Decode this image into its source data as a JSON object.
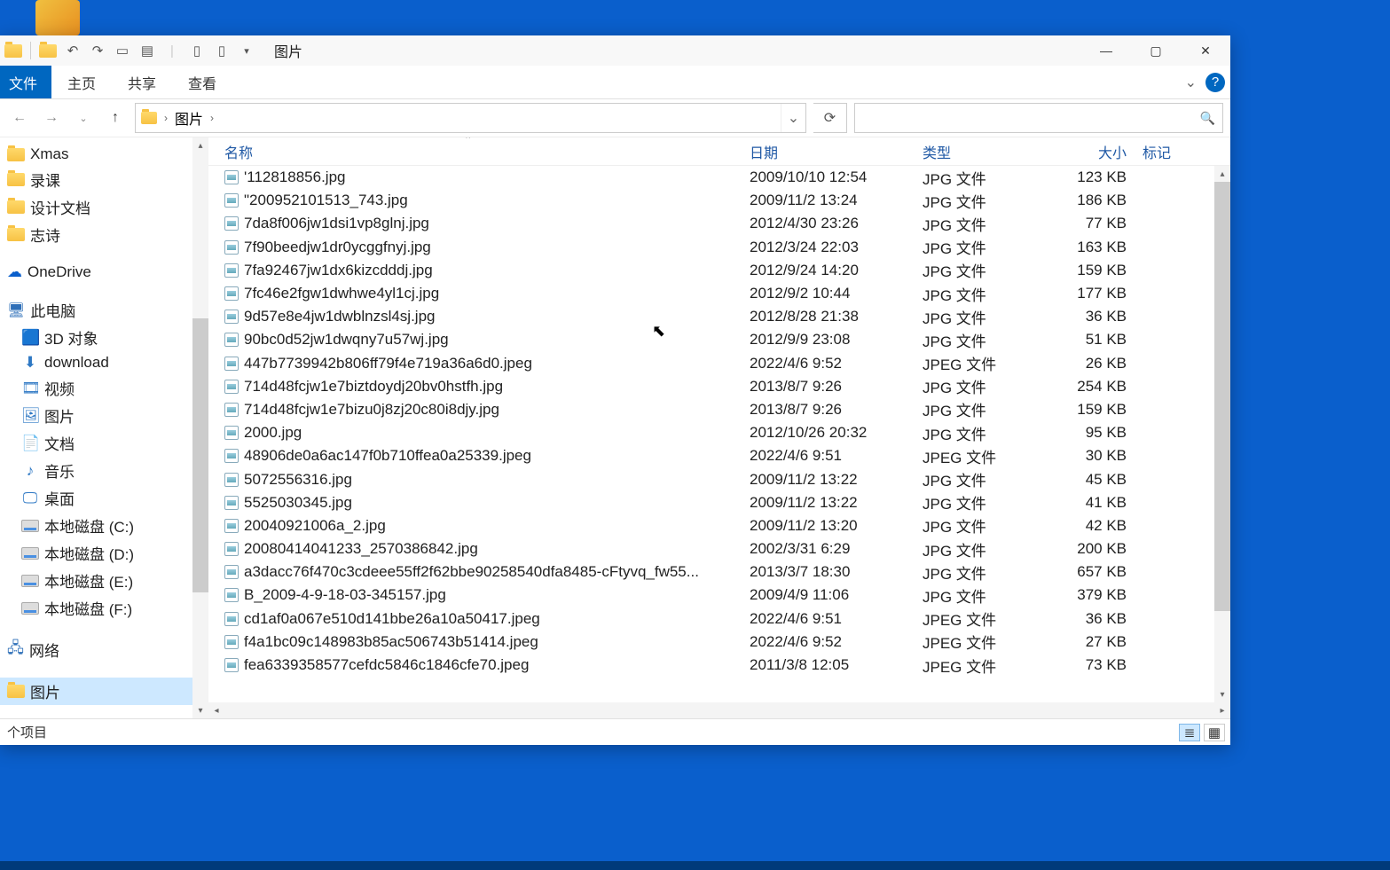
{
  "window_title": "图片",
  "win_controls": {
    "min": "—",
    "max": "▢",
    "close": "✕"
  },
  "qat": {
    "undo": "↶",
    "redo": "↷",
    "delete": "✕",
    "separator_small": "▾"
  },
  "ribbon": {
    "file": "文件",
    "tabs": [
      "主页",
      "共享",
      "查看"
    ],
    "help": "?",
    "expand": "⌄"
  },
  "nav": {
    "back": "←",
    "forward": "→",
    "up": "↑"
  },
  "breadcrumb": {
    "segments": [
      "图片"
    ],
    "chev": "›"
  },
  "refresh": "⟳",
  "search_placeholder": "",
  "search_icon": "🔍",
  "nav_pane": {
    "quick": [
      {
        "label": "Xmas"
      },
      {
        "label": "录课"
      },
      {
        "label": "设计文档"
      },
      {
        "label": "志诗"
      }
    ],
    "onedrive": "OneDrive",
    "this_pc": "此电脑",
    "pc_items": [
      {
        "label": "3D 对象",
        "icon": "3d"
      },
      {
        "label": "download",
        "icon": "download"
      },
      {
        "label": "视频",
        "icon": "video"
      },
      {
        "label": "图片",
        "icon": "pictures"
      },
      {
        "label": "文档",
        "icon": "docs"
      },
      {
        "label": "音乐",
        "icon": "music"
      },
      {
        "label": "桌面",
        "icon": "desktop"
      },
      {
        "label": "本地磁盘 (C:)",
        "icon": "drive"
      },
      {
        "label": "本地磁盘 (D:)",
        "icon": "drive"
      },
      {
        "label": "本地磁盘 (E:)",
        "icon": "drive"
      },
      {
        "label": "本地磁盘 (F:)",
        "icon": "drive"
      }
    ],
    "network": "网络",
    "selected": "图片"
  },
  "columns": {
    "name": "名称",
    "date": "日期",
    "type": "类型",
    "size": "大小",
    "tag": "标记",
    "sort_ind": "⌃"
  },
  "files": [
    {
      "name": "'112818856.jpg",
      "date": "2009/10/10 12:54",
      "type": "JPG 文件",
      "size": "123 KB"
    },
    {
      "name": "\"200952101513_743.jpg",
      "date": "2009/11/2 13:24",
      "type": "JPG 文件",
      "size": "186 KB"
    },
    {
      "name": "7da8f006jw1dsi1vp8glnj.jpg",
      "date": "2012/4/30 23:26",
      "type": "JPG 文件",
      "size": "77 KB"
    },
    {
      "name": "7f90beedjw1dr0ycggfnyj.jpg",
      "date": "2012/3/24 22:03",
      "type": "JPG 文件",
      "size": "163 KB"
    },
    {
      "name": "7fa92467jw1dx6kizcdddj.jpg",
      "date": "2012/9/24 14:20",
      "type": "JPG 文件",
      "size": "159 KB"
    },
    {
      "name": "7fc46e2fgw1dwhwe4yl1cj.jpg",
      "date": "2012/9/2 10:44",
      "type": "JPG 文件",
      "size": "177 KB"
    },
    {
      "name": "9d57e8e4jw1dwblnzsl4sj.jpg",
      "date": "2012/8/28 21:38",
      "type": "JPG 文件",
      "size": "36 KB"
    },
    {
      "name": "90bc0d52jw1dwqny7u57wj.jpg",
      "date": "2012/9/9 23:08",
      "type": "JPG 文件",
      "size": "51 KB"
    },
    {
      "name": "447b7739942b806ff79f4e719a36a6d0.jpeg",
      "date": "2022/4/6 9:52",
      "type": "JPEG 文件",
      "size": "26 KB"
    },
    {
      "name": "714d48fcjw1e7biztdoydj20bv0hstfh.jpg",
      "date": "2013/8/7 9:26",
      "type": "JPG 文件",
      "size": "254 KB"
    },
    {
      "name": "714d48fcjw1e7bizu0j8zj20c80i8djy.jpg",
      "date": "2013/8/7 9:26",
      "type": "JPG 文件",
      "size": "159 KB"
    },
    {
      "name": "2000.jpg",
      "date": "2012/10/26 20:32",
      "type": "JPG 文件",
      "size": "95 KB"
    },
    {
      "name": "48906de0a6ac147f0b710ffea0a25339.jpeg",
      "date": "2022/4/6 9:51",
      "type": "JPEG 文件",
      "size": "30 KB"
    },
    {
      "name": "5072556316.jpg",
      "date": "2009/11/2 13:22",
      "type": "JPG 文件",
      "size": "45 KB"
    },
    {
      "name": "5525030345.jpg",
      "date": "2009/11/2 13:22",
      "type": "JPG 文件",
      "size": "41 KB"
    },
    {
      "name": "20040921006a_2.jpg",
      "date": "2009/11/2 13:20",
      "type": "JPG 文件",
      "size": "42 KB"
    },
    {
      "name": "20080414041233_2570386842.jpg",
      "date": "2002/3/31 6:29",
      "type": "JPG 文件",
      "size": "200 KB"
    },
    {
      "name": "a3dacc76f470c3cdeee55ff2f62bbe90258540dfa8485-cFtyvq_fw55...",
      "date": "2013/3/7 18:30",
      "type": "JPG 文件",
      "size": "657 KB"
    },
    {
      "name": "B_2009-4-9-18-03-345157.jpg",
      "date": "2009/4/9 11:06",
      "type": "JPG 文件",
      "size": "379 KB"
    },
    {
      "name": "cd1af0a067e510d141bbe26a10a50417.jpeg",
      "date": "2022/4/6 9:51",
      "type": "JPEG 文件",
      "size": "36 KB"
    },
    {
      "name": "f4a1bc09c148983b85ac506743b51414.jpeg",
      "date": "2022/4/6 9:52",
      "type": "JPEG 文件",
      "size": "27 KB"
    },
    {
      "name": "fea6339358577cefdc5846c1846cfe70.jpeg",
      "date": "2011/3/8 12:05",
      "type": "JPEG 文件",
      "size": "73 KB"
    }
  ],
  "status_text": "个项目",
  "cursor_glyph": "⬉"
}
